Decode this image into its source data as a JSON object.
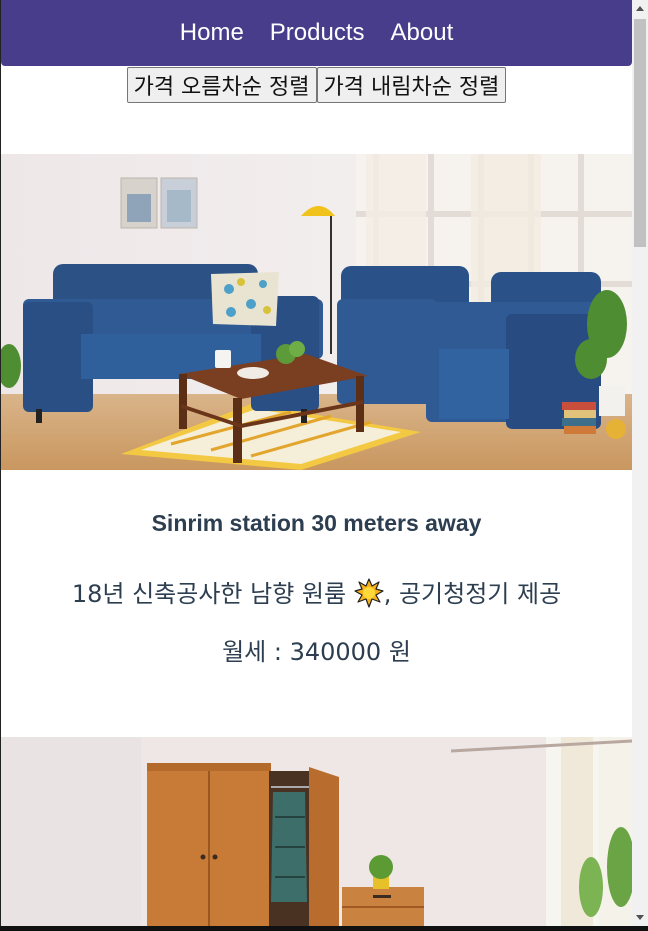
{
  "nav": {
    "links": [
      "Home",
      "Products",
      "About"
    ],
    "background": "#483d8b"
  },
  "sort": {
    "asc_label": "가격 오름차순 정렬",
    "desc_label": "가격 내림차순 정렬"
  },
  "products": [
    {
      "image": "living-room-sofa-photo",
      "title": "Sinrim station 30 meters away",
      "description_before": "18년 신축공사한 남향 원룸 ",
      "description_icon": "sun-icon",
      "description_after": ", 공기청정기 제공",
      "price_label": "월세 : 340000 원"
    },
    {
      "image": "bedroom-wardrobe-photo"
    }
  ],
  "colors": {
    "text": "#2c3e50",
    "accent": "#483d8b"
  }
}
